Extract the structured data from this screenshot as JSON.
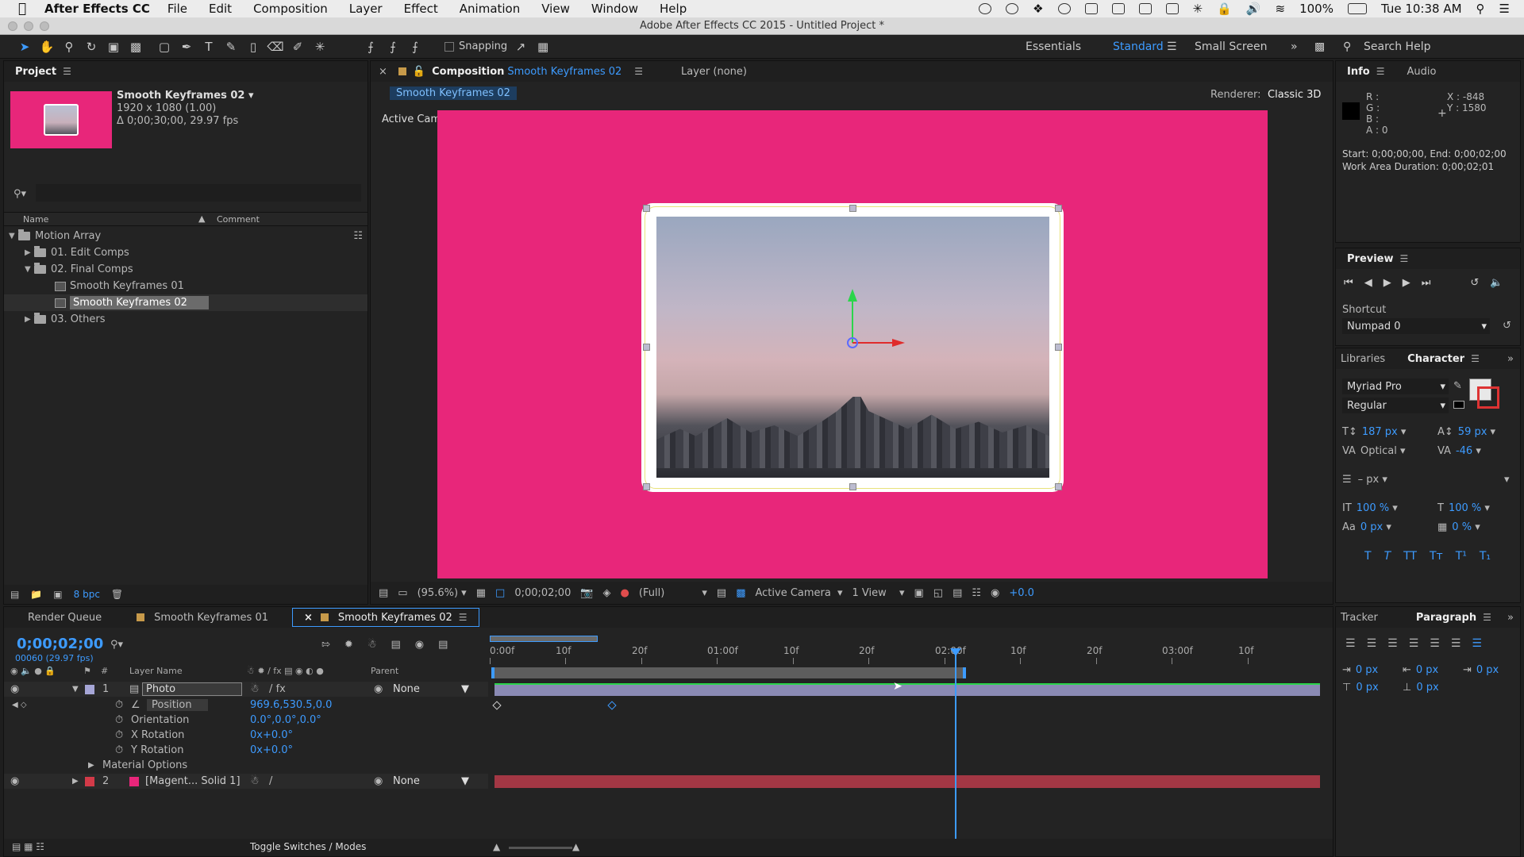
{
  "menubar": {
    "app": "After Effects CC",
    "items": [
      "File",
      "Edit",
      "Composition",
      "Layer",
      "Effect",
      "Animation",
      "View",
      "Window",
      "Help"
    ],
    "battery": "100%",
    "clock": "Tue 10:38 AM"
  },
  "titlebar": {
    "title": "Adobe After Effects CC 2015 - Untitled Project *"
  },
  "toolbar": {
    "snapping": "Snapping",
    "workspaces": [
      "Essentials",
      "Standard",
      "Small Screen"
    ],
    "active_workspace": "Standard",
    "search": "Search Help"
  },
  "project": {
    "tab": "Project",
    "item_name": "Smooth Keyframes 02 ▾",
    "item_size": "1920 x 1080 (1.00)",
    "item_duration": "Δ 0;00;30;00, 29.97 fps",
    "col_name": "Name",
    "col_comment": "Comment",
    "tree": [
      {
        "label": "Motion Array",
        "type": "folder",
        "expanded": true,
        "depth": 0
      },
      {
        "label": "01. Edit Comps",
        "type": "folder",
        "expanded": false,
        "depth": 1
      },
      {
        "label": "02. Final Comps",
        "type": "folder",
        "expanded": true,
        "depth": 1
      },
      {
        "label": "Smooth Keyframes 01",
        "type": "comp",
        "depth": 2
      },
      {
        "label": "Smooth Keyframes 02",
        "type": "comp",
        "depth": 2,
        "selected": true
      },
      {
        "label": "03. Others",
        "type": "folder",
        "expanded": false,
        "depth": 1
      }
    ],
    "bpc": "8 bpc"
  },
  "composition": {
    "tab_prefix": "Composition",
    "tab_name": "Smooth Keyframes 02",
    "layer_tab": "Layer (none)",
    "comp_chip": "Smooth Keyframes 02",
    "renderer_label": "Renderer:",
    "renderer": "Classic 3D",
    "camera_label": "Active Camera",
    "zoom": "(95.6%)",
    "timecode": "0;00;02;00",
    "resolution": "(Full)",
    "camera": "Active Camera",
    "views": "1 View",
    "exposure": "+0.0",
    "bg_color": "#e8267a"
  },
  "info": {
    "tabs": [
      "Info",
      "Audio"
    ],
    "r": "R :",
    "g": "G :",
    "b": "B :",
    "a": "A : 0",
    "x": "X : -848",
    "y": "Y : 1580",
    "start_end": "Start: 0;00;00;00, End: 0;00;02;00",
    "work_area": "Work Area Duration: 0;00;02;01"
  },
  "preview": {
    "title": "Preview",
    "shortcut_label": "Shortcut",
    "shortcut": "Numpad 0"
  },
  "character": {
    "tabs": [
      "Libraries",
      "Character"
    ],
    "font": "Myriad Pro",
    "style": "Regular",
    "size": "187 px",
    "leading": "59 px",
    "kerning": "Optical",
    "tracking": "-46",
    "stroke": "– px",
    "vscale": "100 %",
    "hscale": "100 %",
    "baseline": "0 px",
    "tsume": "0 %"
  },
  "paragraph": {
    "tabs": [
      "Tracker",
      "Paragraph"
    ],
    "indent_left": "0 px",
    "indent_right": "0 px",
    "indent_first": "0 px",
    "space_before": "0 px",
    "space_after": "0 px"
  },
  "timeline": {
    "tabs": [
      "Render Queue",
      "Smooth Keyframes 01",
      "Smooth Keyframes 02"
    ],
    "timecode": "0;00;02;00",
    "fps": "00060 (29.97 fps)",
    "col_layer_name": "Layer Name",
    "col_parent": "Parent",
    "ruler": [
      "0:00f",
      "10f",
      "20f",
      "01:00f",
      "10f",
      "20f",
      "02:00f",
      "10f",
      "20f",
      "03:00f",
      "10f"
    ],
    "layers": [
      {
        "index": "1",
        "name": "Photo",
        "parent": "None",
        "color": "#a6a6d6"
      },
      {
        "index": "2",
        "name": "[Magent... Solid 1]",
        "parent": "None",
        "color": "#d23a48"
      }
    ],
    "properties": [
      {
        "name": "Position",
        "value": "969.6,530.5,0.0"
      },
      {
        "name": "Orientation",
        "value": "0.0°,0.0°,0.0°"
      },
      {
        "name": "X Rotation",
        "value": "0x+0.0°"
      },
      {
        "name": "Y Rotation",
        "value": "0x+0.0°"
      }
    ],
    "material_options": "Material Options",
    "toggle": "Toggle Switches / Modes",
    "playhead_fraction": 0.565
  }
}
